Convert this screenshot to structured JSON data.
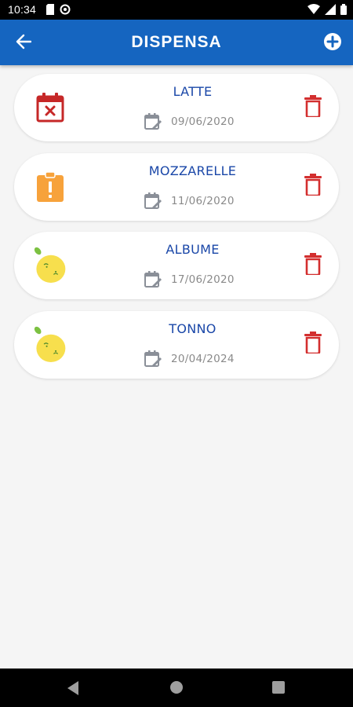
{
  "status_bar": {
    "time": "10:34"
  },
  "app_bar": {
    "title": "DISPENSA"
  },
  "items": [
    {
      "name": "LATTE",
      "date": "09/06/2020",
      "status_icon": "expired-calendar-icon"
    },
    {
      "name": "MOZZARELLE",
      "date": "11/06/2020",
      "status_icon": "warning-clipboard-icon"
    },
    {
      "name": "ALBUME",
      "date": "17/06/2020",
      "status_icon": "fresh-lemon-icon"
    },
    {
      "name": "TONNO",
      "date": "20/04/2024",
      "status_icon": "fresh-lemon-icon"
    }
  ],
  "colors": {
    "primary": "#1565c0",
    "item_name": "#1a47a8",
    "delete": "#d32f2f",
    "warning": "#f7a23b",
    "lemon": "#f7df4d",
    "date_text": "#8a8a8a"
  }
}
